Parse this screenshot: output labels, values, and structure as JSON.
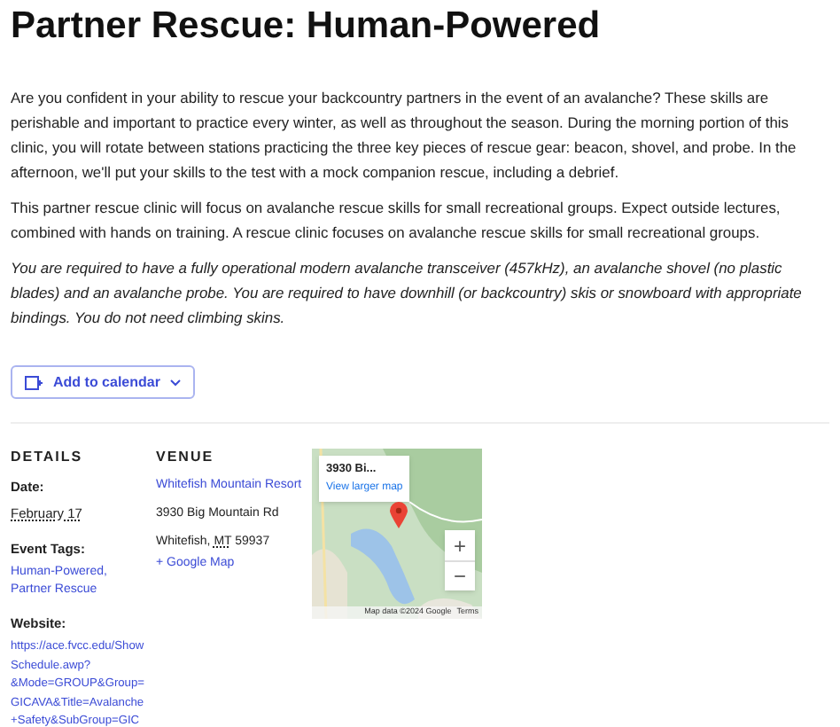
{
  "title": "Partner Rescue: Human-Powered",
  "paragraphs": [
    {
      "text": "Are you confident in your ability to rescue your backcountry partners in the event of an avalanche? These skills are perishable and important to practice every winter, as well as throughout the season. During the morning portion of this clinic, you will rotate between stations practicing the three key pieces of rescue gear: beacon, shovel, and probe. In the afternoon, we'll put your skills to the test with a mock companion rescue, including a debrief.",
      "italic": false
    },
    {
      "text": "This partner rescue clinic will focus on avalanche rescue skills for small recreational groups. Expect outside lectures, combined with hands on training. A rescue clinic focuses on avalanche rescue skills for small recreational groups.",
      "italic": false
    },
    {
      "text": "You are required to have a fully operational modern avalanche transceiver (457kHz), an avalanche shovel (no plastic blades) and an avalanche probe. You are required to have downhill (or backcountry) skis or snowboard with appropriate bindings. You do not need climbing skins.",
      "italic": true
    }
  ],
  "calendar_button": {
    "label": "Add to calendar"
  },
  "details": {
    "heading": "DETAILS",
    "date_label": "Date:",
    "date": "February 17",
    "tags_label": "Event Tags:",
    "tags": "Human-Powered, Partner Rescue",
    "website_label": "Website:",
    "website": [
      "https://ace.fvcc.edu/Show",
      "Schedule.awp?",
      "&Mode=GROUP&Group=",
      "GICAVA&Title=Avalanche",
      "+Safety&SubGroup=GIC"
    ]
  },
  "venue": {
    "heading": "VENUE",
    "name": "Whitefish Mountain Resort",
    "street": "3930 Big Mountain Rd",
    "city": "Whitefish,",
    "state": "MT",
    "zip": "59937",
    "map_link": "+ Google Map"
  },
  "map": {
    "place": "3930 Bi...",
    "larger_link": "View larger map",
    "zoom_in": "+",
    "zoom_out": "−",
    "attribution": "Map data ©2024 Google",
    "terms": "Terms"
  }
}
